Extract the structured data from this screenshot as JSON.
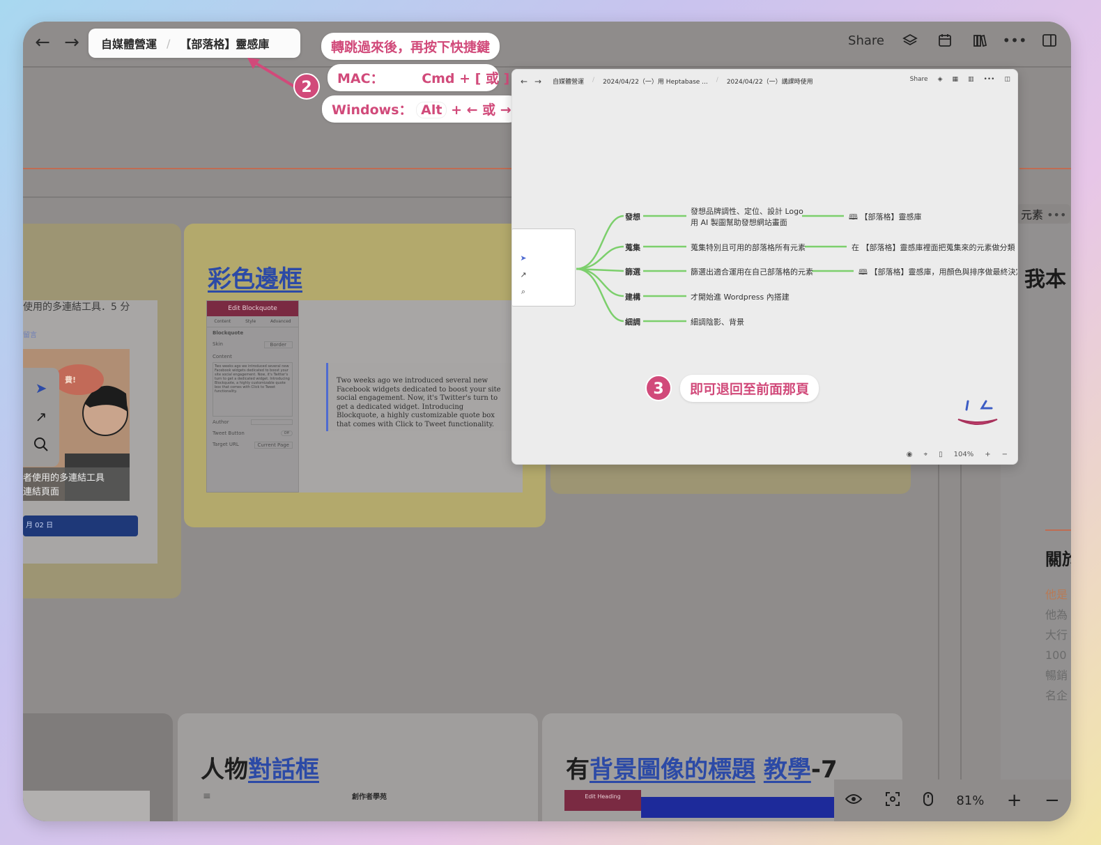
{
  "topbar": {
    "back_icon": "arrow-left-icon",
    "forward_icon": "arrow-right-icon",
    "breadcrumb": [
      "自媒體營運",
      "【部落格】靈感庫"
    ],
    "share_label": "Share",
    "icons": [
      "layers-icon",
      "calendar-icon",
      "library-icon",
      "more-icon",
      "sidebar-icon"
    ]
  },
  "callouts": {
    "after_jump": "轉跳過來後，再按下快捷鍵",
    "mac_label": "MAC：",
    "mac_keys": "Cmd + [ 或 ]",
    "windows_label": "Windows：",
    "windows_alt": "Alt",
    "windows_keys": "+ ← 或 →",
    "badge_2": "2",
    "badge_3": "3",
    "go_back": "即可退回至前面那頁"
  },
  "cards": {
    "left_caption": "使用的多連結工具．5 分",
    "left_tag": "留言",
    "left_image_text": "者使用的多連結工具",
    "left_image_text2": "連結頁面",
    "left_badge_text": "費!",
    "left_date": "月 02 日",
    "color_border_title": "彩色邊框",
    "elementor_header": "Edit Blockquote",
    "elementor_tabs": [
      "Content",
      "Style",
      "Advanced"
    ],
    "elementor_section": "Blockquote",
    "elementor_skin_label": "Skin",
    "elementor_skin_value": "Border",
    "elementor_content_label": "Content",
    "elementor_content_text": "Two weeks ago we introduced several new Facebook widgets dedicated to boost your site social engagement. Now, it's Twitter's turn to get a dedicated widget. Introducing Blockquote, a highly customizable quote box that comes with Click to Tweet functionality.",
    "elementor_author_label": "Author",
    "elementor_tweet_label": "Tweet Button",
    "elementor_tweet_toggle": "Off",
    "elementor_target_label": "Target URL",
    "elementor_target_value": "Current Page",
    "blockquote_text": "Two weeks ago we introduced several new Facebook widgets dedicated to boost your site social engagement. Now, it's Twitter's turn to get a dedicated widget. Introducing Blockquote, a highly customizable quote box that comes with Click to Tweet functionality.",
    "dialog_title_a": "人物",
    "dialog_title_b": "對話框",
    "dialog_logo": "創作者學苑",
    "bg_title_a": "有",
    "bg_title_b": "背景圖像的標題",
    "bg_title_c": "教學",
    "bg_title_d": "-7",
    "bg_elementor_header": "Edit Heading"
  },
  "popup": {
    "breadcrumb": [
      "自媒體營運",
      "2024/04/22（一）用 Heptabase ...",
      "2024/04/22（一）講課時使用"
    ],
    "share_label": "Share",
    "mindmap": [
      {
        "branch": "發想",
        "text": "發想品牌調性、定位、設計 Logo",
        "text2": "用 AI 製圖幫助發想網站畫面",
        "link": "【部落格】靈感庫"
      },
      {
        "branch": "蒐集",
        "text": "蒐集特別且可用的部落格所有元素",
        "link": "在 【部落格】靈感庫裡面把蒐集來的元素做分類"
      },
      {
        "branch": "篩選",
        "text": "篩選出適合運用在自己部落格的元素",
        "link": "【部落格】靈感庫，用顏色與排序做最終決定"
      },
      {
        "branch": "建構",
        "text": "才開始進 Wordpress 內搭建"
      },
      {
        "branch": "細調",
        "text": "細調陰影、背景"
      }
    ],
    "zoom": "104%"
  },
  "right_column": {
    "chip": "元素",
    "title": "我本",
    "heading2": "關於",
    "lines": [
      "他是",
      "他為",
      "大行",
      "100 1",
      "暢銷",
      "名企"
    ]
  },
  "zoom_bar": {
    "zoom": "81%",
    "plus": "+",
    "minus": "−"
  },
  "colors": {
    "accent_pink": "#d14a7a",
    "link_blue": "#2c4aa6",
    "mindmap_green": "#7ccf6c"
  }
}
